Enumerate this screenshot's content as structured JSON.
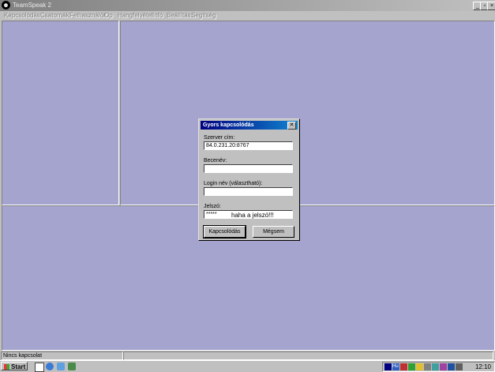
{
  "window": {
    "title": "TeamSpeak 2",
    "icon": "teamspeak-icon"
  },
  "menu": [
    {
      "label": "Kapcsolódás"
    },
    {
      "label": "Csatornák"
    },
    {
      "label": "Felhasználók"
    },
    {
      "label": "Op"
    },
    {
      "label": "Hangfelvétel"
    },
    {
      "label": "Infó"
    },
    {
      "label": "Beállítás"
    },
    {
      "label": "Segítség"
    }
  ],
  "colors": {
    "pane": "#a4a4cf",
    "dialog_title": "#000080"
  },
  "dialog": {
    "title": "Gyors kapcsolódás",
    "server_label": "Szerver cím:",
    "server_value": "84.0.231.20:8767",
    "nickname_label": "Becenév:",
    "nickname_value": "",
    "login_label": "Login név (választható):",
    "login_value": "",
    "password_label": "Jelszó:",
    "password_value": "*****",
    "password_note": "haha a jelszó!!!",
    "connect_label": "Kapcsolódás",
    "cancel_label": "Mégsem"
  },
  "status": {
    "text": "Nincs kapcsolat"
  },
  "taskbar": {
    "start_label": "Start",
    "clock": "12:10"
  }
}
